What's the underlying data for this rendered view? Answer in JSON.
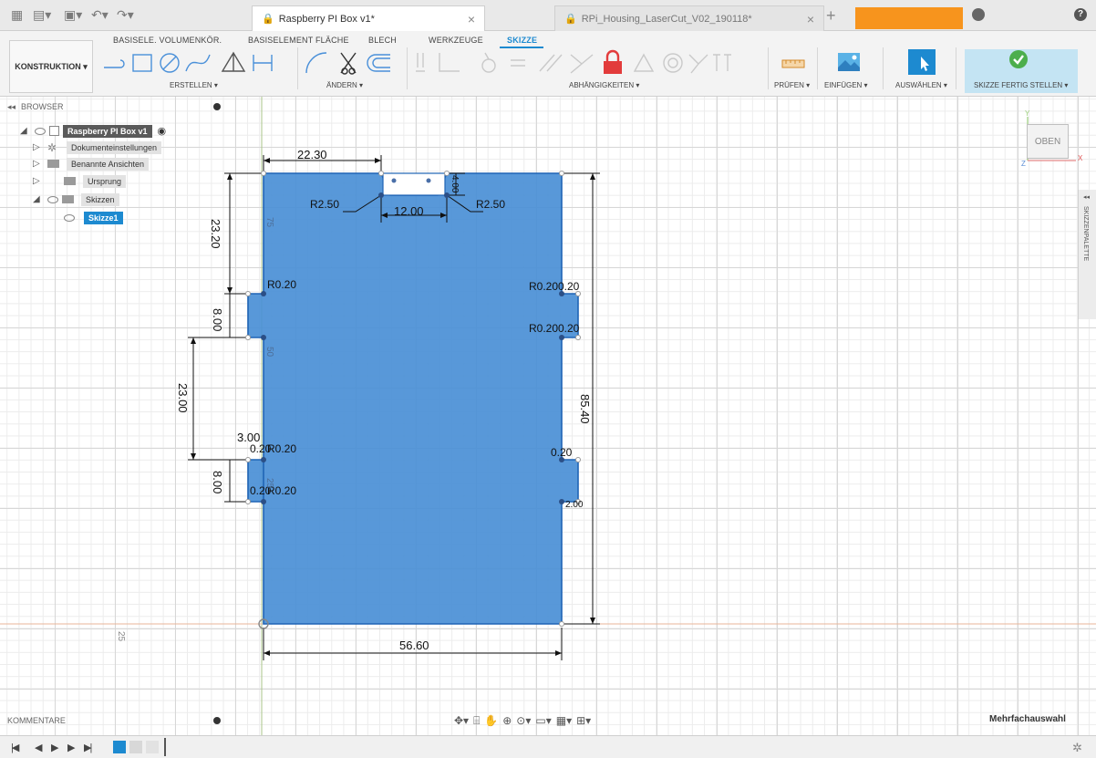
{
  "titlebar": {
    "tabs": [
      {
        "title": "Raspberry PI Box v1*",
        "active": true
      },
      {
        "title": "RPi_Housing_LaserCut_V02_190118*",
        "active": false
      }
    ],
    "close_glyph": "×",
    "add_glyph": "+",
    "help_glyph": "?"
  },
  "ribbon": {
    "tabs": [
      "BASISELE. VOLUMENKÖR.",
      "BASISELEMENT FLÄCHE",
      "BLECH",
      "WERKZEUGE",
      "SKIZZE"
    ],
    "active_tab": "SKIZZE",
    "workspace": "KONSTRUKTION ▾",
    "groups": [
      "ERSTELLEN ▾",
      "ÄNDERN ▾",
      "ABHÄNGIGKEITEN ▾",
      "PRÜFEN ▾",
      "EINFÜGEN ▾",
      "AUSWÄHLEN ▾",
      "SKIZZE FERTIG STELLEN ▾"
    ],
    "accent": "#1d8ad0",
    "finish_color": "#4cae4c"
  },
  "browser": {
    "title": "BROWSER",
    "items": [
      {
        "label": "Raspberry PI Box v1",
        "level": 0
      },
      {
        "label": "Dokumenteinstellungen",
        "level": 1
      },
      {
        "label": "Benannte Ansichten",
        "level": 1
      },
      {
        "label": "Ursprung",
        "level": 1
      },
      {
        "label": "Skizzen",
        "level": 1
      },
      {
        "label": "Skizze1",
        "level": 2
      }
    ]
  },
  "viewcube": {
    "label": "OBEN"
  },
  "palette": {
    "label": "SKIZZENPALETTE"
  },
  "sketch": {
    "fill_color": "#4a8fd6",
    "outline_color": "#1f64b5",
    "dimensions": [
      "22.30",
      "12.00",
      "23.20",
      "8.00",
      "23.00",
      "8.00",
      "3.00",
      "85.40",
      "56.60",
      "4.00",
      "2.00"
    ],
    "radii": [
      "R2.50",
      "R2.50",
      "R0.20",
      "R0.20",
      "R0.20",
      "R0.20",
      "R0.20",
      "0.20",
      "0.20",
      "0.20",
      "0.20",
      "0.20"
    ],
    "grid_labels": [
      "75",
      "50",
      "25",
      "25"
    ]
  },
  "comments": {
    "title": "KOMMENTARE"
  },
  "status": {
    "multi_select": "Mehrfachauswahl"
  },
  "timeline": {
    "transport": [
      "|◀",
      "◀",
      "▶",
      "▶",
      "▶|"
    ]
  }
}
